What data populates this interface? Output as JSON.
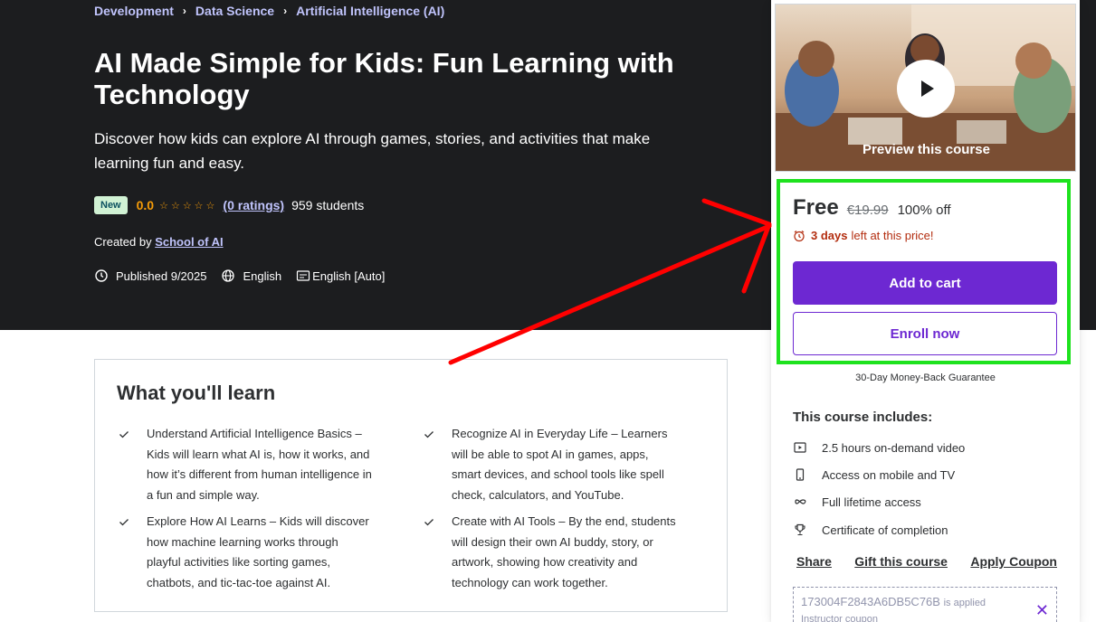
{
  "breadcrumb": [
    "Development",
    "Data Science",
    "Artificial Intelligence (AI)"
  ],
  "course": {
    "title": "AI Made Simple for Kids: Fun Learning with Technology",
    "subtitle": "Discover how kids can explore AI through games, stories, and activities that make learning fun and easy.",
    "badge": "New",
    "rating": "0.0",
    "stars": "☆☆☆☆☆",
    "ratings_link": "(0 ratings)",
    "students": "959 students",
    "created_prefix": "Created by",
    "instructor": "School of AI",
    "published": "Published 9/2025",
    "language": "English",
    "captions": "English [Auto]"
  },
  "learn": {
    "title": "What you'll learn",
    "items": [
      "Understand Artificial Intelligence Basics – Kids will learn what AI is, how it works, and how it’s different from human intelligence in a fun and simple way.",
      "Recognize AI in Everyday Life – Learners will be able to spot AI in games, apps, smart devices, and school tools like spell check, calculators, and YouTube.",
      "Explore How AI Learns – Kids will discover how machine learning works through playful activities like sorting games, chatbots, and tic-tac-toe against AI.",
      "Create with AI Tools – By the end, students will design their own AI buddy, story, or artwork, showing how creativity and technology can work together."
    ]
  },
  "sidebar": {
    "preview_label": "Preview this course",
    "price": "Free",
    "old_price": "€19.99",
    "discount": "100% off",
    "timer_bold": "3 days",
    "timer_rest": "left at this price!",
    "add_to_cart": "Add to cart",
    "enroll": "Enroll now",
    "guarantee": "30-Day Money-Back Guarantee",
    "includes_title": "This course includes:",
    "includes": [
      "2.5 hours on-demand video",
      "Access on mobile and TV",
      "Full lifetime access",
      "Certificate of completion"
    ],
    "share": "Share",
    "gift": "Gift this course",
    "coupon_link": "Apply Coupon",
    "coupon_code": "173004F2843A6DB5C76B",
    "coupon_applied": "is applied",
    "coupon_sub": "Instructor coupon"
  },
  "colors": {
    "hero_bg": "#1c1d1f",
    "accent_purple": "#6d28d2",
    "link_lavender": "#c0c4fc",
    "star_orange": "#f69c08",
    "timer_red": "#b32d0f",
    "highlight_green": "#1ee21e",
    "arrow_red": "#ff0000"
  },
  "icons": [
    "chevron-right-icon",
    "star-icon",
    "clock-icon",
    "globe-icon",
    "captions-icon",
    "check-icon",
    "play-icon",
    "alarm-icon",
    "video-icon",
    "mobile-icon",
    "infinity-icon",
    "trophy-icon",
    "close-icon"
  ]
}
